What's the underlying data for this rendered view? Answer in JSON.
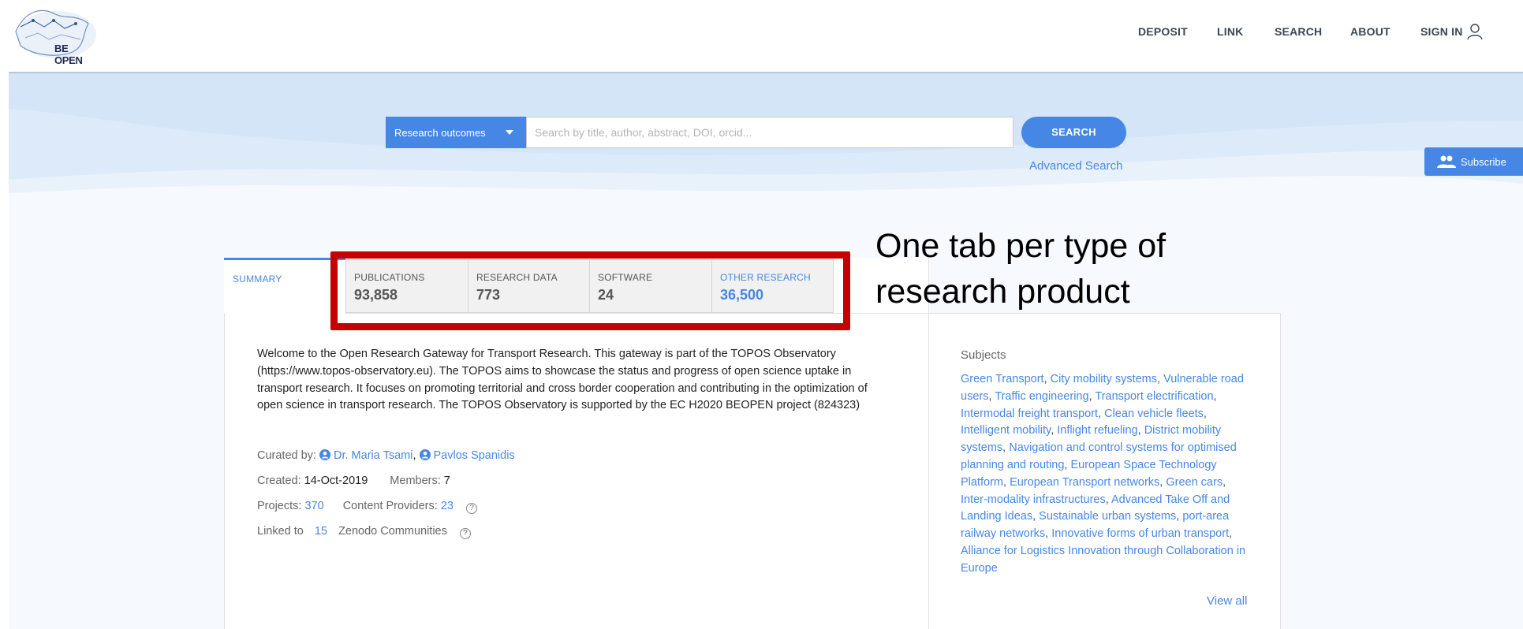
{
  "header": {
    "logo_text": "BE OPEN",
    "nav": [
      "DEPOSIT",
      "LINK",
      "SEARCH",
      "ABOUT",
      "SIGN IN"
    ],
    "user_icon": "user-icon"
  },
  "search": {
    "type_selected": "Research outcomes",
    "placeholder": "Search by title, author, abstract, DOI, orcid...",
    "button_label": "SEARCH",
    "advanced_label": "Advanced Search"
  },
  "subscribe": {
    "label": "Subscribe",
    "icon": "people-icon"
  },
  "tabs": {
    "summary": "SUMMARY",
    "items": [
      {
        "label": "PUBLICATIONS",
        "count": "93,858"
      },
      {
        "label": "RESEARCH DATA",
        "count": "773"
      },
      {
        "label": "SOFTWARE",
        "count": "24"
      },
      {
        "label": "OTHER RESEARCH",
        "count": "36,500"
      }
    ]
  },
  "annotation": "One tab per type of research product",
  "description": "Welcome to the Open Research Gateway for Transport Research. This gateway is part of the TOPOS Observatory (https://www.topos-observatory.eu). The TOPOS aims to showcase the status and progress of open science uptake in transport research. It focuses on promoting territorial and cross border cooperation and contributing in the optimization of open science in transport research. The TOPOS Observatory is supported by the EC H2020 BEOPEN project (824323)",
  "meta": {
    "curated_label": "Curated by:",
    "curators": [
      "Dr. Maria Tsami",
      "Pavlos Spanidis"
    ],
    "created_label": "Created:",
    "created": "14-Oct-2019",
    "members_label": "Members:",
    "members": "7",
    "projects_label": "Projects:",
    "projects": "370",
    "providers_label": "Content Providers:",
    "providers": "23",
    "linked_label": "Linked to",
    "linked": "15",
    "zenodo_label": "Zenodo Communities",
    "help_glyph": "?"
  },
  "subjects": {
    "title": "Subjects",
    "items": [
      "Green Transport",
      "City mobility systems",
      "Vulnerable road users",
      "Traffic engineering",
      "Transport electrification",
      "Intermodal freight transport",
      "Clean vehicle fleets",
      "Intelligent mobility",
      "Inflight refueling",
      "District mobility systems",
      "Navigation and control systems for optimised planning and routing",
      "European Space Technology Platform",
      "European Transport networks",
      "Green cars",
      "Inter-modality infrastructures",
      "Advanced Take Off and Landing Ideas",
      "Sustainable urban systems",
      "port-area railway networks",
      "Innovative forms of urban transport",
      "Alliance for Logistics Innovation through Collaboration in Europe"
    ],
    "view_all": "View all"
  },
  "colors": {
    "accent": "#4687e6",
    "highlight": "#c40000"
  }
}
